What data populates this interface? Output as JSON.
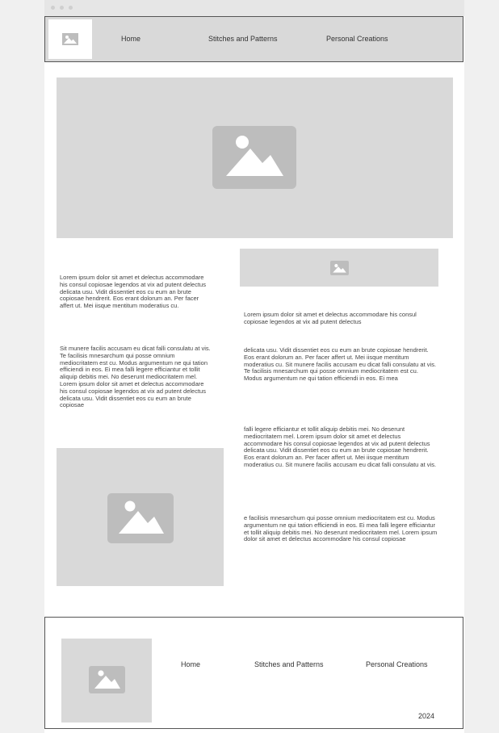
{
  "nav": {
    "logo_icon": "image-icon",
    "links": [
      "Home",
      "Stitches and Patterns",
      "Personal Creations"
    ]
  },
  "hero": {
    "icon": "image-icon"
  },
  "small_banner": {
    "icon": "image-icon"
  },
  "left_column": {
    "paragraph_1": "Lorem ipsum dolor sit amet et delectus accommodare his consul copiosae legendos at vix ad putent delectus delicata usu. Vidit dissentiet eos cu eum an brute copiosae hendrerit. Eos erant dolorum an. Per facer affert ut. Mei iisque mentitum moderatius cu.",
    "paragraph_2": "Sit munere facilis accusam eu dicat falli consulatu at vis. Te facilisis mnesarchum qui posse omnium mediocritatem est cu. Modus argumentum ne qui tation efficiendi in eos. Ei mea falli legere efficiantur et tollit aliquip debitis mei. No deserunt mediocritatem mel. Lorem ipsum dolor sit amet et delectus accommodare his consul copiosae legendos at vix ad putent delectus delicata usu. Vidit dissentiet eos cu eum an brute copiosae",
    "image_icon": "image-icon"
  },
  "right_column": {
    "paragraph_1": "Lorem ipsum dolor sit amet et delectus accommodare his consul copiosae legendos at vix ad putent delectus",
    "paragraph_2": "delicata usu. Vidit dissentiet eos cu eum an brute copiosae hendrerit. Eos erant dolorum an. Per facer affert ut. Mei iisque mentitum moderatius cu. Sit munere facilis accusam eu dicat falli consulatu at vis. Te facilisis mnesarchum qui posse omnium mediocritatem est cu. Modus argumentum ne qui tation efficiendi in eos. Ei mea",
    "paragraph_3": "falli legere efficiantur et tollit aliquip debitis mei. No deserunt mediocritatem mel. Lorem ipsum dolor sit amet et delectus accommodare his consul copiosae legendos at vix ad putent delectus delicata usu. Vidit dissentiet eos cu eum an brute copiosae hendrerit. Eos erant dolorum an. Per facer affert ut. Mei iisque mentitum moderatius cu. Sit munere facilis accusam eu dicat falli consulatu at vis.",
    "paragraph_4": "e facilisis mnesarchum qui posse omnium mediocritatem est cu. Modus argumentum ne qui tation efficiendi in eos. Ei mea falli legere efficiantur et tollit aliquip debitis mei. No deserunt mediocritatem mel. Lorem ipsum dolor sit amet et delectus accommodare his consul copiosae"
  },
  "footer": {
    "logo_icon": "image-icon",
    "links": [
      "Home",
      "Stitches and Patterns",
      "Personal Creations"
    ],
    "year": "2024"
  },
  "colors": {
    "placeholder": "#d9d9d9",
    "icon": "#bdbdbd",
    "border": "#555555"
  }
}
